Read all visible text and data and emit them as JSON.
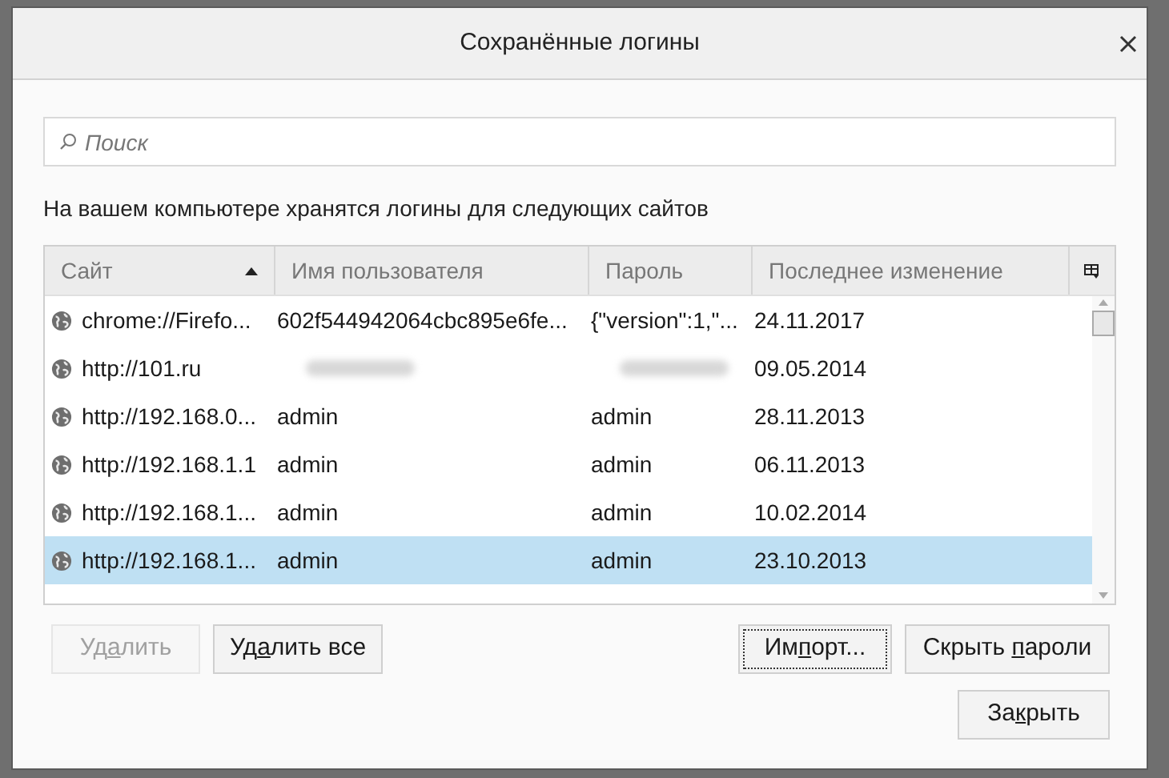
{
  "dialog": {
    "title": "Сохранённые логины"
  },
  "search": {
    "placeholder": "Поиск"
  },
  "description": "На вашем компьютере хранятся логины для следующих сайтов",
  "table": {
    "columns": [
      {
        "label": "Сайт",
        "sorted": true
      },
      {
        "label": "Имя пользователя",
        "sorted": false
      },
      {
        "label": "Пароль",
        "sorted": false
      },
      {
        "label": "Последнее изменение",
        "sorted": false
      }
    ],
    "rows": [
      {
        "site": "chrome://Firefo...",
        "user": {
          "text": "602f544942064cbc895e6fe...",
          "blurred": false
        },
        "password": {
          "text": "{\"version\":1,\"...",
          "blurred": false
        },
        "changed": "24.11.2017",
        "selected": false
      },
      {
        "site": "http://101.ru",
        "user": {
          "blurred": true
        },
        "password": {
          "blurred": true
        },
        "changed": "09.05.2014",
        "selected": false
      },
      {
        "site": "http://192.168.0...",
        "user": {
          "text": "admin",
          "blurred": false
        },
        "password": {
          "text": "admin",
          "blurred": false
        },
        "changed": "28.11.2013",
        "selected": false
      },
      {
        "site": "http://192.168.1.1",
        "user": {
          "text": "admin",
          "blurred": false
        },
        "password": {
          "text": "admin",
          "blurred": false
        },
        "changed": "06.11.2013",
        "selected": false
      },
      {
        "site": "http://192.168.1...",
        "user": {
          "text": "admin",
          "blurred": false
        },
        "password": {
          "text": "admin",
          "blurred": false
        },
        "changed": "10.02.2014",
        "selected": false
      },
      {
        "site": "http://192.168.1...",
        "user": {
          "text": "admin",
          "blurred": false
        },
        "password": {
          "text": "admin",
          "blurred": false
        },
        "changed": "23.10.2013",
        "selected": true
      }
    ]
  },
  "buttons": [
    {
      "label_parts": [
        "Уд",
        "а",
        "лить"
      ],
      "disabled": true,
      "focused": false
    },
    {
      "label_parts": [
        "Уд",
        "а",
        "лить все"
      ],
      "disabled": false,
      "focused": false
    },
    {
      "label_parts": [
        "Им",
        "п",
        "орт..."
      ],
      "disabled": false,
      "focused": true
    },
    {
      "label_parts": [
        "Скрыть ",
        "п",
        "ароли"
      ],
      "disabled": false,
      "focused": false
    },
    {
      "label_parts": [
        "За",
        "к",
        "рыть"
      ],
      "disabled": false,
      "focused": false
    }
  ]
}
